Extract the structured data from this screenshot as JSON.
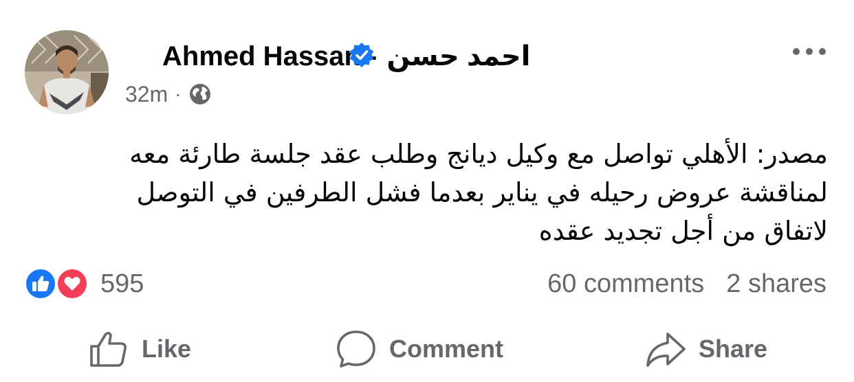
{
  "post": {
    "author_name": "Ahmed Hassan",
    "author_separator": "-",
    "author_name_ar": "احمد حسن",
    "verified_icon": "verified-badge-icon",
    "time": "32m",
    "meta_dot": "·",
    "privacy_icon": "globe-icon",
    "more_icon": "more-options-icon",
    "text_lines": [
      "مصدر: الأهلي تواصل مع وكيل ديانج وطلب عقد جلسة طارئة معه",
      "لمناقشة عروض رحيله في يناير بعدما فشل الطرفين في التوصل",
      "لاتفاق من أجل تجديد عقده"
    ]
  },
  "reactions": {
    "icons": [
      "like-reaction-icon",
      "love-reaction-icon"
    ],
    "count": "595",
    "comments": "60 comments",
    "shares": "2 shares"
  },
  "actions": {
    "like_label": "Like",
    "comment_label": "Comment",
    "share_label": "Share"
  },
  "colors": {
    "accent_blue": "#1877f2",
    "love_red": "#f33e58",
    "secondary_text": "#65676b"
  }
}
